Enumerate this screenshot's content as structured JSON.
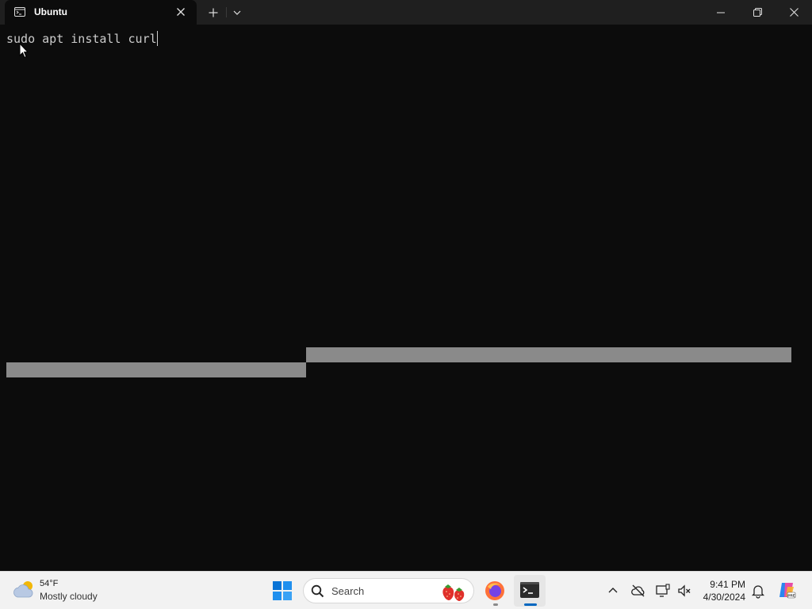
{
  "window": {
    "tab_title": "Ubuntu"
  },
  "terminal": {
    "command_text": "sudo apt install curl",
    "background": "#0c0c0c",
    "text_color": "#cccccc",
    "selection_color": "#8a8a8a"
  },
  "titlebar_icons": {
    "tab_icon": "terminal-icon",
    "close": "close-icon",
    "new_tab": "plus-icon",
    "dropdown": "chevron-down-icon",
    "minimize": "minimize-icon",
    "maximize": "restore-icon",
    "window_close": "close-icon"
  },
  "taskbar": {
    "weather": {
      "temp": "54°F",
      "desc": "Mostly cloudy",
      "icon": "partly-cloudy-icon"
    },
    "search": {
      "label": "Search"
    },
    "apps": [
      "windows-start-icon",
      "firefox-icon",
      "terminal-icon"
    ],
    "tray": [
      "chevron-up-icon",
      "onedrive-offline-icon",
      "display-icon",
      "volume-muted-icon",
      "bell-icon",
      "copilot-icon"
    ],
    "clock": {
      "time": "9:41 PM",
      "date": "4/30/2024"
    },
    "accent": "#0067c0"
  }
}
